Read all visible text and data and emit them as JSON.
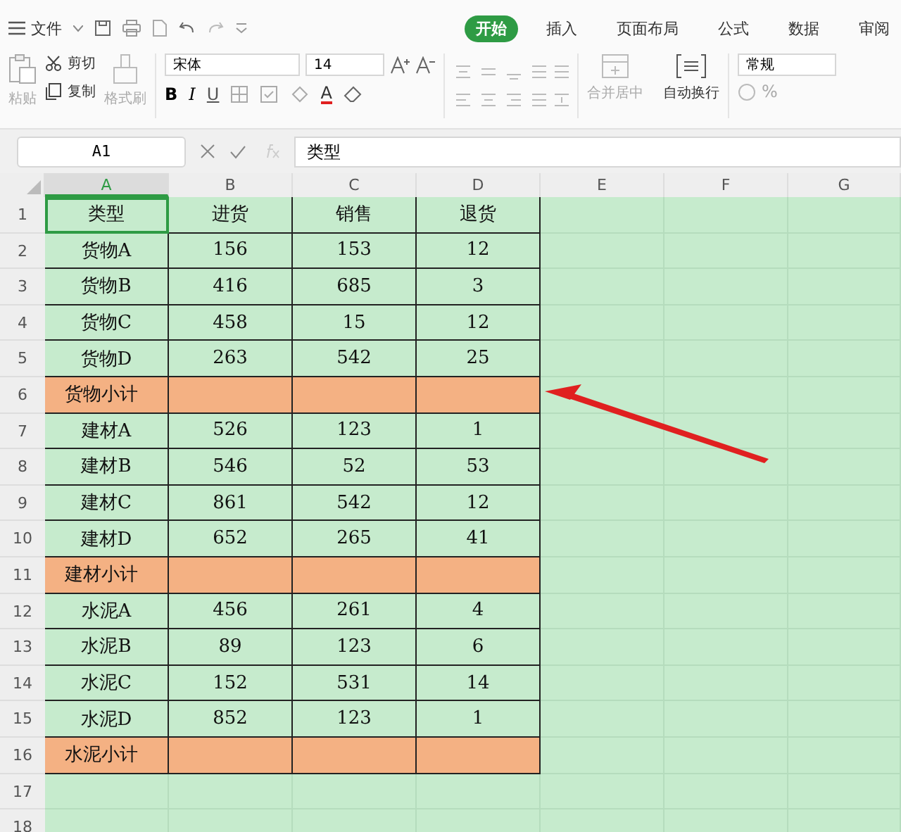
{
  "quick_bar": {
    "file_menu": "文件"
  },
  "tabs": [
    {
      "label": "开始",
      "selected": true
    },
    {
      "label": "插入",
      "selected": false
    },
    {
      "label": "页面布局",
      "selected": false
    },
    {
      "label": "公式",
      "selected": false
    },
    {
      "label": "数据",
      "selected": false
    },
    {
      "label": "审阅",
      "selected": false
    }
  ],
  "ribbon": {
    "paste": "粘贴",
    "cut": "剪切",
    "copy": "复制",
    "format_painter": "格式刷",
    "font_name": "宋体",
    "font_size": "14",
    "bold": "B",
    "italic": "I",
    "underline": "U",
    "font_color": "A",
    "merge": "合并居中",
    "wrap": "自动换行",
    "number_format": "常规",
    "percent": "%"
  },
  "formula_bar": {
    "name_box": "A1",
    "formula": "类型"
  },
  "columns": [
    {
      "label": "A",
      "selected": true
    },
    {
      "label": "B",
      "selected": false
    },
    {
      "label": "C",
      "selected": false
    },
    {
      "label": "D",
      "selected": false
    },
    {
      "label": "E",
      "selected": false
    },
    {
      "label": "F",
      "selected": false
    },
    {
      "label": "G",
      "selected": false
    }
  ],
  "rows": [
    {
      "number": "1",
      "kind": "header",
      "cells": [
        "类型",
        "进货",
        "销售",
        "退货"
      ]
    },
    {
      "number": "2",
      "kind": "item",
      "cells": [
        "货物A",
        "156",
        "153",
        "12"
      ]
    },
    {
      "number": "3",
      "kind": "item",
      "cells": [
        "货物B",
        "416",
        "685",
        "3"
      ]
    },
    {
      "number": "4",
      "kind": "item",
      "cells": [
        "货物C",
        "458",
        "15",
        "12"
      ]
    },
    {
      "number": "5",
      "kind": "item",
      "cells": [
        "货物D",
        "263",
        "542",
        "25"
      ]
    },
    {
      "number": "6",
      "kind": "subtotal",
      "cells": [
        "货物小计"
      ]
    },
    {
      "number": "7",
      "kind": "item",
      "cells": [
        "建材A",
        "526",
        "123",
        "1"
      ]
    },
    {
      "number": "8",
      "kind": "item",
      "cells": [
        "建材B",
        "546",
        "52",
        "53"
      ]
    },
    {
      "number": "9",
      "kind": "item",
      "cells": [
        "建材C",
        "861",
        "542",
        "12"
      ]
    },
    {
      "number": "10",
      "kind": "item",
      "cells": [
        "建材D",
        "652",
        "265",
        "41"
      ]
    },
    {
      "number": "11",
      "kind": "subtotal",
      "cells": [
        "建材小计"
      ]
    },
    {
      "number": "12",
      "kind": "item",
      "cells": [
        "水泥A",
        "456",
        "261",
        "4"
      ]
    },
    {
      "number": "13",
      "kind": "item",
      "cells": [
        "水泥B",
        "89",
        "123",
        "6"
      ]
    },
    {
      "number": "14",
      "kind": "item",
      "cells": [
        "水泥C",
        "152",
        "531",
        "14"
      ]
    },
    {
      "number": "15",
      "kind": "item",
      "cells": [
        "水泥D",
        "852",
        "123",
        "1"
      ]
    },
    {
      "number": "16",
      "kind": "subtotal",
      "cells": [
        "水泥小计"
      ]
    },
    {
      "number": "17",
      "kind": "empty",
      "cells": []
    },
    {
      "number": "18",
      "kind": "empty",
      "cells": []
    }
  ]
}
